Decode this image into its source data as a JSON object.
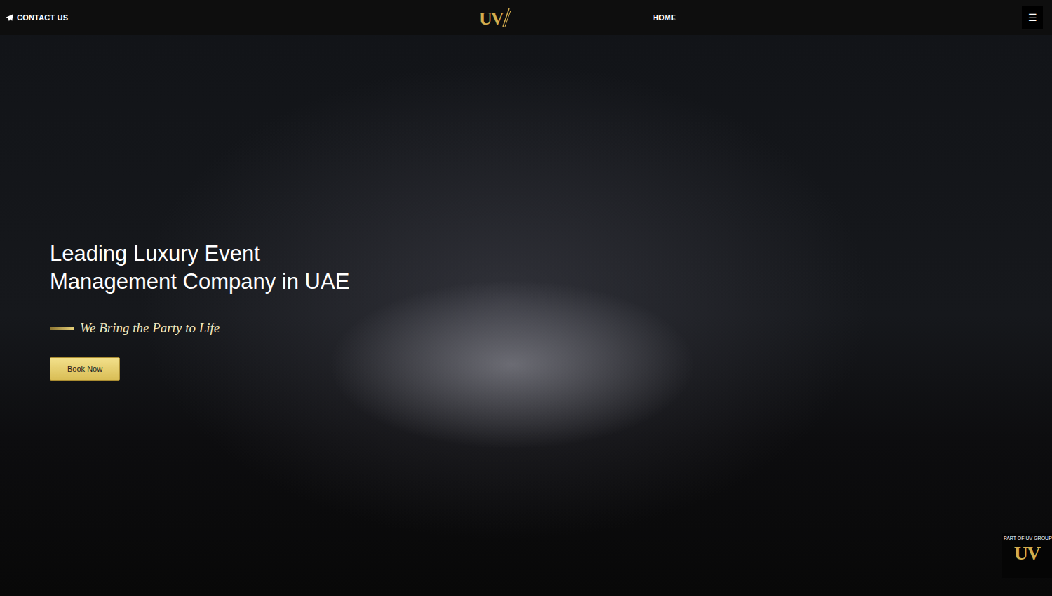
{
  "nav": {
    "contact": "CONTACT US",
    "logo": "UV",
    "links": [
      {
        "label": "HOME"
      }
    ],
    "menu_icon": "☰"
  },
  "hero": {
    "title": "Leading Luxury Event Management Company in UAE",
    "tagline": "We Bring the Party to Life",
    "button": "Book Now"
  },
  "badge": {
    "caption": "PART OF UV GROUP",
    "logo": "UV"
  }
}
